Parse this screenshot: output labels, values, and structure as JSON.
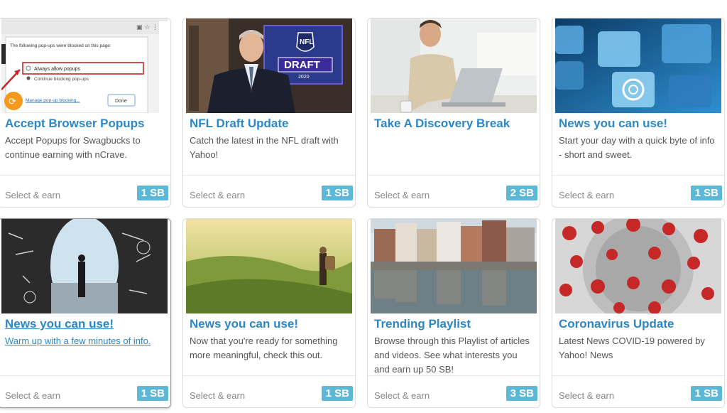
{
  "cards": [
    {
      "title": "Accept Browser Popups",
      "description": "Accept Popups for Swagbucks to continue earning with nCrave.",
      "earn_label": "Select & earn",
      "points": "1 SB",
      "popup": {
        "blocked_msg": "The following pop-ups were blocked on this page:",
        "allow": "Always allow popups",
        "block": "Continue blocking pop-ups",
        "manage": "Manage pop-up blocking...",
        "done": "Done"
      }
    },
    {
      "title": "NFL Draft Update",
      "description": "Catch the latest in the NFL draft with Yahoo!",
      "earn_label": "Select & earn",
      "points": "1 SB",
      "logo": {
        "top": "NFL",
        "bottom": "DRAFT",
        "year": "2020"
      }
    },
    {
      "title": "Take A Discovery Break",
      "description": "",
      "earn_label": "Select & earn",
      "points": "2 SB"
    },
    {
      "title": "News you can use!",
      "description": "Start your day with a quick byte of info - short and sweet.",
      "earn_label": "Select & earn",
      "points": "1 SB"
    },
    {
      "title": "News you can use!",
      "description": "Warm up with a few minutes of info.",
      "earn_label": "Select & earn",
      "points": "1 SB"
    },
    {
      "title": "News you can use!",
      "description": "Now that you're ready for something more meaningful, check this out.",
      "earn_label": "Select & earn",
      "points": "1 SB"
    },
    {
      "title": "Trending Playlist",
      "description": "Browse through this Playlist of articles and videos. See what interests you and earn up 50 SB!",
      "earn_label": "Select & earn",
      "points": "3 SB"
    },
    {
      "title": "Coronavirus Update",
      "description": "Latest News COVID-19 powered by Yahoo! News",
      "earn_label": "Select & earn",
      "points": "1 SB"
    }
  ],
  "colors": {
    "title": "#2d87c4",
    "badge": "#5cb8d6",
    "earn": "#888888",
    "text": "#555555"
  }
}
